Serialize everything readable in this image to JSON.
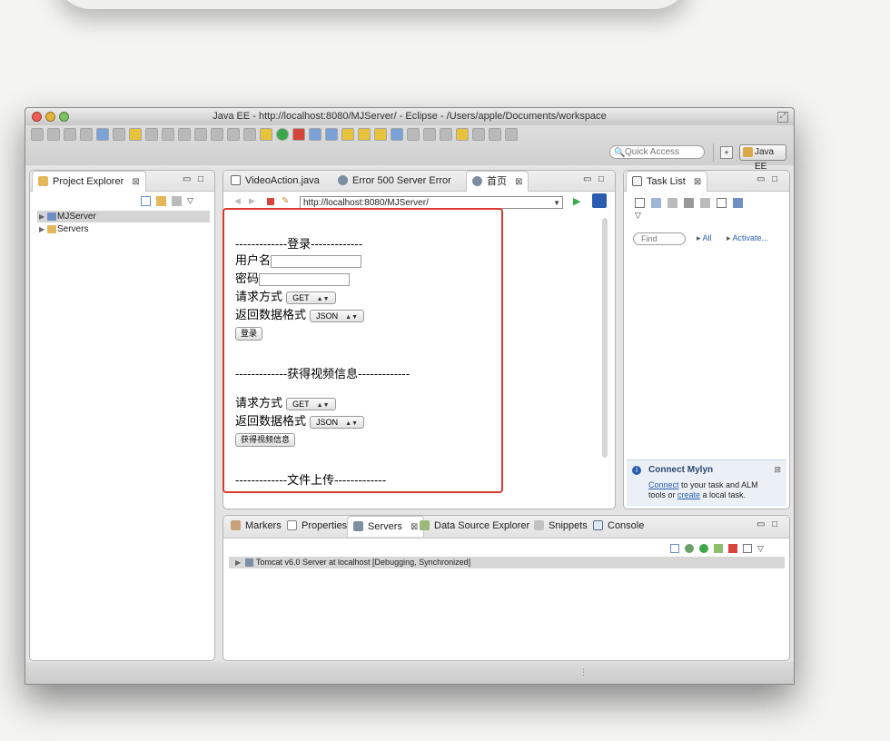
{
  "window": {
    "title": "Java EE - http://localhost:8080/MJServer/ - Eclipse - /Users/apple/Documents/workspace"
  },
  "toolbar": {
    "quick_access_placeholder": "Quick Access",
    "perspective": "Java EE"
  },
  "project_explorer": {
    "tab_label": "Project Explorer",
    "items": [
      {
        "label": "MJServer",
        "selected": true
      },
      {
        "label": "Servers",
        "selected": false
      }
    ]
  },
  "editor": {
    "tabs": [
      {
        "label": "VideoAction.java"
      },
      {
        "label": "Error 500 Server Error"
      },
      {
        "label": "首页",
        "active": true
      }
    ],
    "url": "http://localhost:8080/MJServer/",
    "page": {
      "login_header": "-------------登录-------------",
      "username_label": "用户名",
      "password_label": "密码",
      "method_label": "请求方式",
      "method_value": "GET",
      "format_label": "返回数据格式",
      "format_value": "JSON",
      "login_button": "登录",
      "video_header": "-------------获得视频信息-------------",
      "video_method_label": "请求方式",
      "video_method_value": "GET",
      "video_format_label": "返回数据格式",
      "video_format_value": "JSON",
      "video_button": "获得视频信息",
      "upload_header": "-------------文件上传-------------"
    }
  },
  "task_list": {
    "tab_label": "Task List",
    "find_placeholder": "Find",
    "all_label": "All",
    "activate_label": "Activate...",
    "mylyn": {
      "title": "Connect Mylyn",
      "connect_link": "Connect",
      "text1": " to your task and ALM",
      "text2": "tools or ",
      "create_link": "create",
      "text3": " a local task."
    }
  },
  "bottom": {
    "tabs": [
      {
        "label": "Markers"
      },
      {
        "label": "Properties"
      },
      {
        "label": "Servers",
        "active": true
      },
      {
        "label": "Data Source Explorer"
      },
      {
        "label": "Snippets"
      },
      {
        "label": "Console"
      }
    ],
    "server_row": "Tomcat v6.0 Server at localhost  [Debugging, Synchronized]"
  },
  "colors": {
    "highlight": "#d83a32",
    "link": "#2a5db0"
  }
}
